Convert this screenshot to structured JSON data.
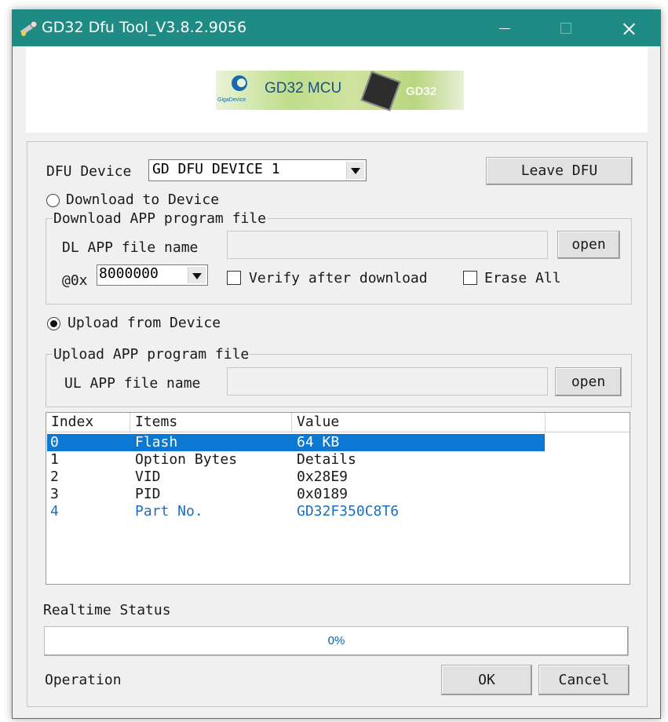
{
  "window": {
    "title": "GD32 Dfu Tool_V3.8.2.9056",
    "accent_color": "#1e8b84"
  },
  "banner": {
    "brand": "GigaDevice",
    "product": "GD32 MCU",
    "watermark": "GD32"
  },
  "dfu": {
    "device_label": "DFU Device",
    "device_value": "GD DFU DEVICE 1",
    "leave_button": "Leave DFU"
  },
  "download": {
    "radio_label": "Download to Device",
    "selected": false,
    "group_title": "Download APP program file",
    "file_label": "DL APP file name",
    "file_value": "",
    "open_button": "open",
    "address_prefix": "@0x",
    "address_value": "8000000",
    "verify_label": "Verify after download",
    "verify_checked": false,
    "erase_label": "Erase All",
    "erase_checked": false
  },
  "upload": {
    "radio_label": "Upload from Device",
    "selected": true,
    "group_title": "Upload APP program file",
    "file_label": "UL APP file name",
    "file_value": "",
    "open_button": "open"
  },
  "device_info": {
    "columns": [
      "Index",
      "Items",
      "Value",
      ""
    ],
    "rows": [
      {
        "index": "0",
        "item": "Flash",
        "value": "64 KB"
      },
      {
        "index": "1",
        "item": "Option Bytes",
        "value": "Details"
      },
      {
        "index": "2",
        "item": "VID",
        "value": "0x28E9"
      },
      {
        "index": "3",
        "item": "PID",
        "value": "0x0189"
      },
      {
        "index": "4",
        "item": "Part No.",
        "value": "GD32F350C8T6"
      }
    ],
    "selected_row": 0,
    "highlight_color": "#0b78d3",
    "link_color": "#1c6fbf"
  },
  "status": {
    "label": "Realtime Status",
    "progress_text": "0%",
    "progress_fraction": 0,
    "operation_label": "Operation"
  },
  "actions": {
    "ok": "OK",
    "cancel": "Cancel"
  }
}
